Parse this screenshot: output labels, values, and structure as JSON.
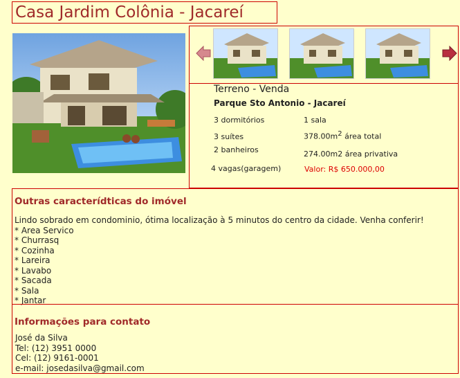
{
  "title": "Casa Jardim Colônia - Jacareí",
  "colors": {
    "accent": "#a02a2a",
    "border": "#cc0000",
    "background": "#ffffcc",
    "price": "#dd0000"
  },
  "carousel": {
    "prev_icon": "arrow-left-icon",
    "next_icon": "arrow-right-icon",
    "thumbnail_count": 3
  },
  "listing": {
    "type": "Terreno - Venda",
    "location": "Parque Sto Antonio - Jacareí",
    "bedrooms": "3 dormitórios",
    "rooms": "1 sala",
    "suites": "3 suítes",
    "total_area_value": "378.00m",
    "total_area_sup": "2",
    "total_area_label": " área total",
    "bathrooms": "2 banheiros",
    "private_area": "274.00m2 área privativa",
    "parking": "4 vagas(garagem)",
    "price": "Valor: R$ 650.000,00"
  },
  "features": {
    "heading": "Outras caracterídticas do imóvel",
    "description": "Lindo sobrado em condominio, ótima localização à 5 minutos do centro da cidade. Venha conferir!",
    "items": [
      "* Area Servico",
      "* Churrasq",
      "* Cozinha",
      "* Lareira",
      "* Lavabo",
      "* Sacada",
      "* Sala",
      "* Jantar"
    ]
  },
  "contact": {
    "heading": "Informações para contato",
    "name": "José da Silva",
    "tel": "Tel: (12) 3951 0000",
    "cel": "Cel: (12) 9161-0001",
    "email": "e-mail: josedasilva@gmail.com"
  }
}
